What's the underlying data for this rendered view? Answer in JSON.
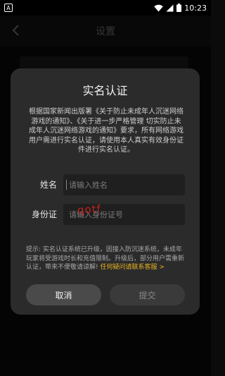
{
  "status_bar": {
    "app_badge": "A",
    "time": "10:23"
  },
  "background": {
    "title": "设置"
  },
  "dialog": {
    "title": "实名认证",
    "description": "根据国家新闻出版署《关于防止未成年人沉迷网络游戏的通知》、《关于进一步严格管理 切实防止未成年人沉迷网络游戏的通知》要求，所有网络游戏用户需进行实名认证，请使用本人真实有效身份证件进行实名认证。",
    "name_label": "姓名",
    "name_placeholder": "请输入姓名",
    "id_label": "身份证",
    "id_placeholder": "请输入身份证号",
    "scribble": "qotf",
    "notice_text": "提示: 实名认证系统已升级，因接入防沉迷系统，未成年玩家将受游戏时长和充值限制。升级后，部分用户需重新认证，带来不便敬请谅解! ",
    "notice_link": "任何疑问请联系客服 >",
    "cancel_label": "取消",
    "submit_label": "提交"
  },
  "colors": {
    "accent_link": "#e8b221",
    "dialog_bg": "#2b2b2b",
    "scribble": "#c3221f"
  }
}
